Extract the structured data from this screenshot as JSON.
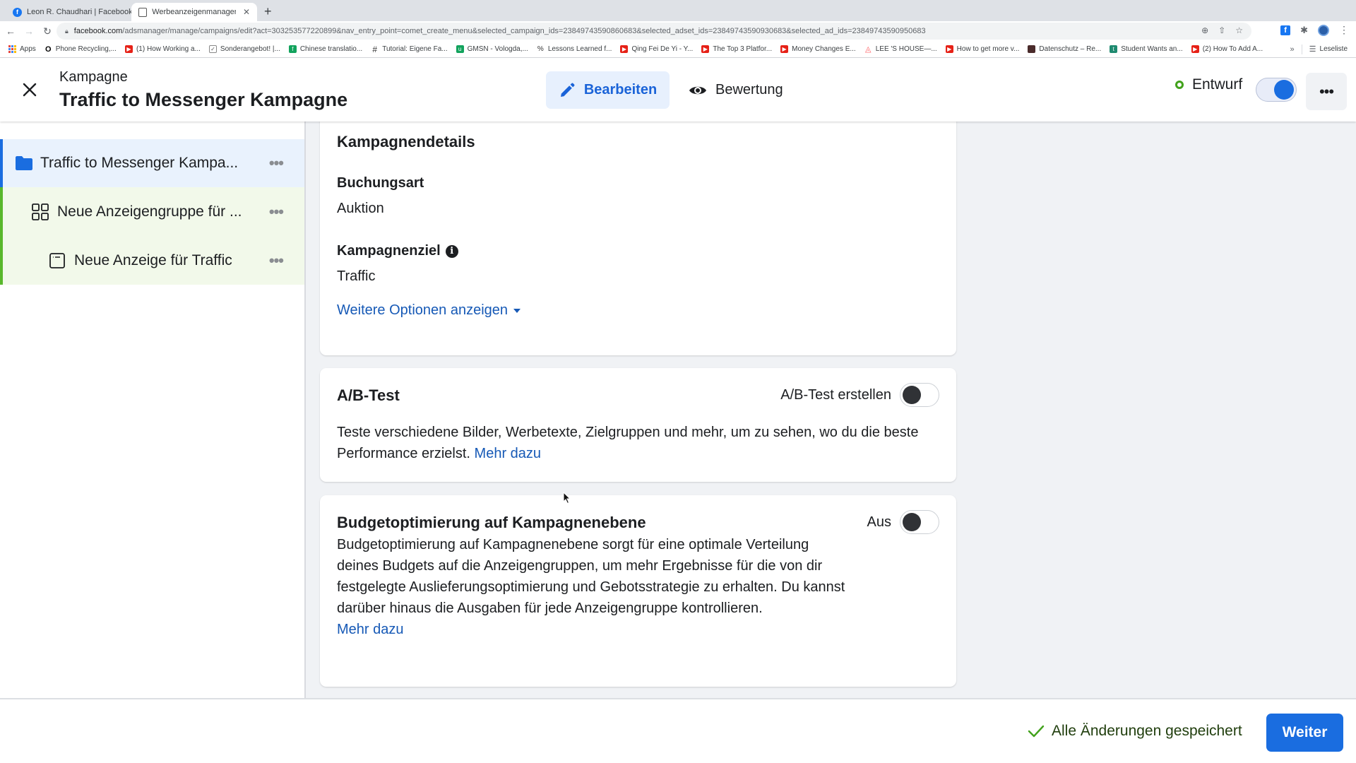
{
  "browser": {
    "tabs": [
      {
        "title": "Leon R. Chaudhari | Facebook",
        "active": false,
        "icon": "facebook-icon"
      },
      {
        "title": "Werbeanzeigenmanager - Wer",
        "active": true,
        "icon": "ads-manager-icon"
      }
    ],
    "new_tab_label": "+",
    "url_host": "facebook.com",
    "url_path": "/adsmanager/manage/campaigns/edit?act=303253577220899&nav_entry_point=comet_create_menu&selected_campaign_ids=23849743590860683&selected_adset_ids=23849743590930683&selected_ad_ids=23849743590950683",
    "bookmarks": [
      {
        "label": "Apps",
        "icon": "apps-grid-icon"
      },
      {
        "label": "Phone Recycling,...",
        "icon": "o2-icon"
      },
      {
        "label": "(1) How Working a...",
        "icon": "youtube-icon"
      },
      {
        "label": "Sonderangebot! |...",
        "icon": "check-circle-icon"
      },
      {
        "label": "Chinese translatio...",
        "icon": "fiverr-icon"
      },
      {
        "label": "Tutorial: Eigene Fa...",
        "icon": "hashtag-icon"
      },
      {
        "label": "GMSN - Vologda,...",
        "icon": "upwork-icon"
      },
      {
        "label": "Lessons Learned f...",
        "icon": "percent-icon"
      },
      {
        "label": "Qing Fei De Yi - Y...",
        "icon": "youtube-icon"
      },
      {
        "label": "The Top 3 Platfor...",
        "icon": "youtube-icon"
      },
      {
        "label": "Money Changes E...",
        "icon": "youtube-icon"
      },
      {
        "label": "LEE 'S HOUSE—...",
        "icon": "airbnb-icon"
      },
      {
        "label": "How to get more v...",
        "icon": "youtube-icon"
      },
      {
        "label": "Datenschutz – Re...",
        "icon": "image-icon"
      },
      {
        "label": "Student Wants an...",
        "icon": "t-circle-icon"
      },
      {
        "label": "(2) How To Add A...",
        "icon": "youtube-icon"
      }
    ],
    "bookmarks_overflow": "»",
    "reading_list": "Leseliste"
  },
  "header": {
    "kicker": "Kampagne",
    "title": "Traffic to Messenger Kampagne",
    "modes": [
      {
        "label": "Bearbeiten",
        "icon": "pencil-icon",
        "active": true
      },
      {
        "label": "Bewertung",
        "icon": "eye-icon",
        "active": false
      }
    ],
    "status": "Entwurf",
    "status_toggle_on": true,
    "more_label": "•••"
  },
  "sidebar": {
    "items": [
      {
        "label": "Traffic to Messenger Kampa...",
        "level": "campaign",
        "icon": "folder-icon",
        "more": "•••"
      },
      {
        "label": "Neue Anzeigengruppe für ...",
        "level": "adset",
        "icon": "grid-icon",
        "more": "•••"
      },
      {
        "label": "Neue Anzeige für Traffic",
        "level": "ad",
        "icon": "ad-window-icon",
        "more": "•••"
      }
    ]
  },
  "cards": {
    "details": {
      "title": "Kampagnendetails",
      "buying_type_label": "Buchungsart",
      "buying_type_value": "Auktion",
      "objective_label": "Kampagnenziel",
      "objective_value": "Traffic",
      "more_options": "Weitere Optionen anzeigen"
    },
    "ab_test": {
      "title": "A/B-Test",
      "toggle_label": "A/B-Test erstellen",
      "toggle_on": false,
      "description": "Teste verschiedene Bilder, Werbetexte, Zielgruppen und mehr, um zu sehen, wo du die beste Performance erzielst.",
      "link": "Mehr dazu"
    },
    "budget": {
      "title": "Budgetoptimierung auf Kampagnenebene",
      "toggle_label": "Aus",
      "toggle_on": false,
      "description": "Budgetoptimierung auf Kampagnenebene sorgt für eine optimale Verteilung deines Budgets auf die Anzeigengruppen, um mehr Ergebnisse für die von dir festgelegte Auslieferungsoptimierung und Gebotsstrategie zu erhalten. Du kannst darüber hinaus die Ausgaben für jede Anzeigengruppe kontrollieren.",
      "link": "Mehr dazu"
    }
  },
  "footer": {
    "saved_status": "Alle Änderungen gespeichert",
    "next_button": "Weiter"
  },
  "colors": {
    "accent": "#1a6de0",
    "link": "#1659b6",
    "campaign_row_bg": "#e9f2fd",
    "adset_row_bg": "#f2f9ea",
    "status_green": "#42a21c"
  }
}
